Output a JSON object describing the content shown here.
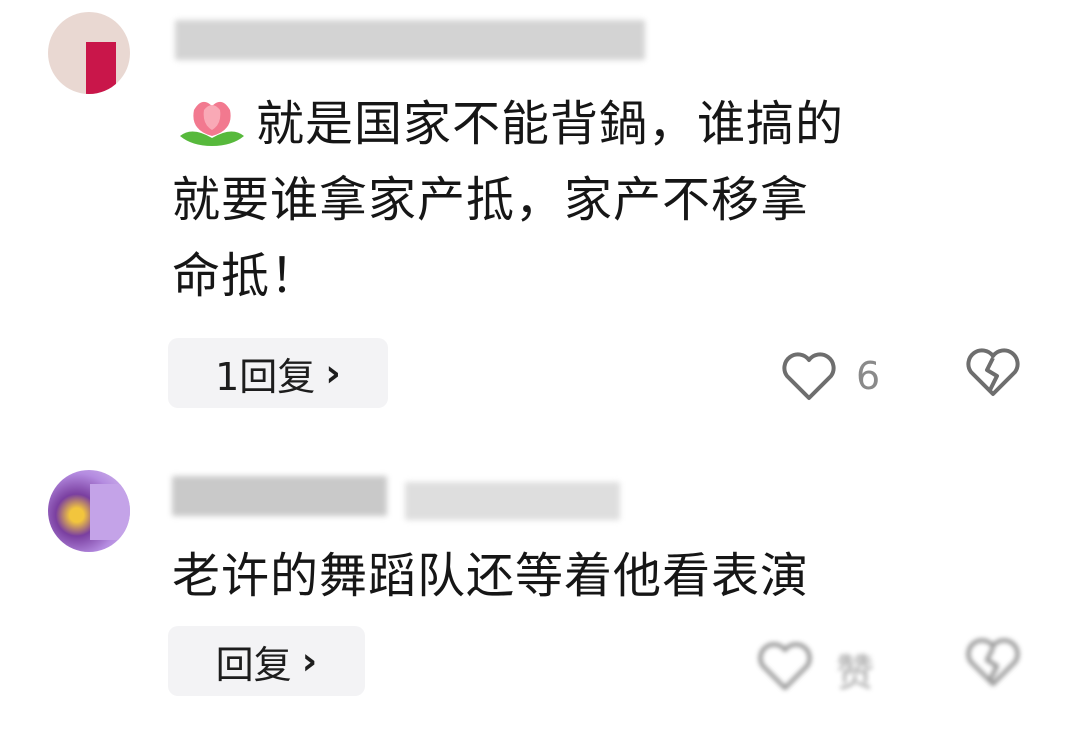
{
  "comments": [
    {
      "text_line1": "就是国家不能背鍋，谁搞的",
      "text_line2": "就要谁拿家产抵，家产不移拿",
      "text_line3": "命抵！",
      "emoji": "tulip-emoji",
      "reply_label": "1回复",
      "reply_chevron": "›",
      "like_count": "6",
      "like_icon": "heart-outline-icon",
      "dislike_icon": "broken-heart-icon"
    },
    {
      "text_line1": "老许的舞蹈队还等着他看表演",
      "reply_label": "回复",
      "reply_chevron": "›",
      "like_label": "赞",
      "like_icon": "heart-outline-icon",
      "dislike_icon": "broken-heart-icon"
    }
  ],
  "colors": {
    "background": "#ffffff",
    "text": "#161616",
    "reply_bg": "#f3f3f5",
    "icon_stroke": "#6e6e6e",
    "count": "#8a8a8a"
  }
}
